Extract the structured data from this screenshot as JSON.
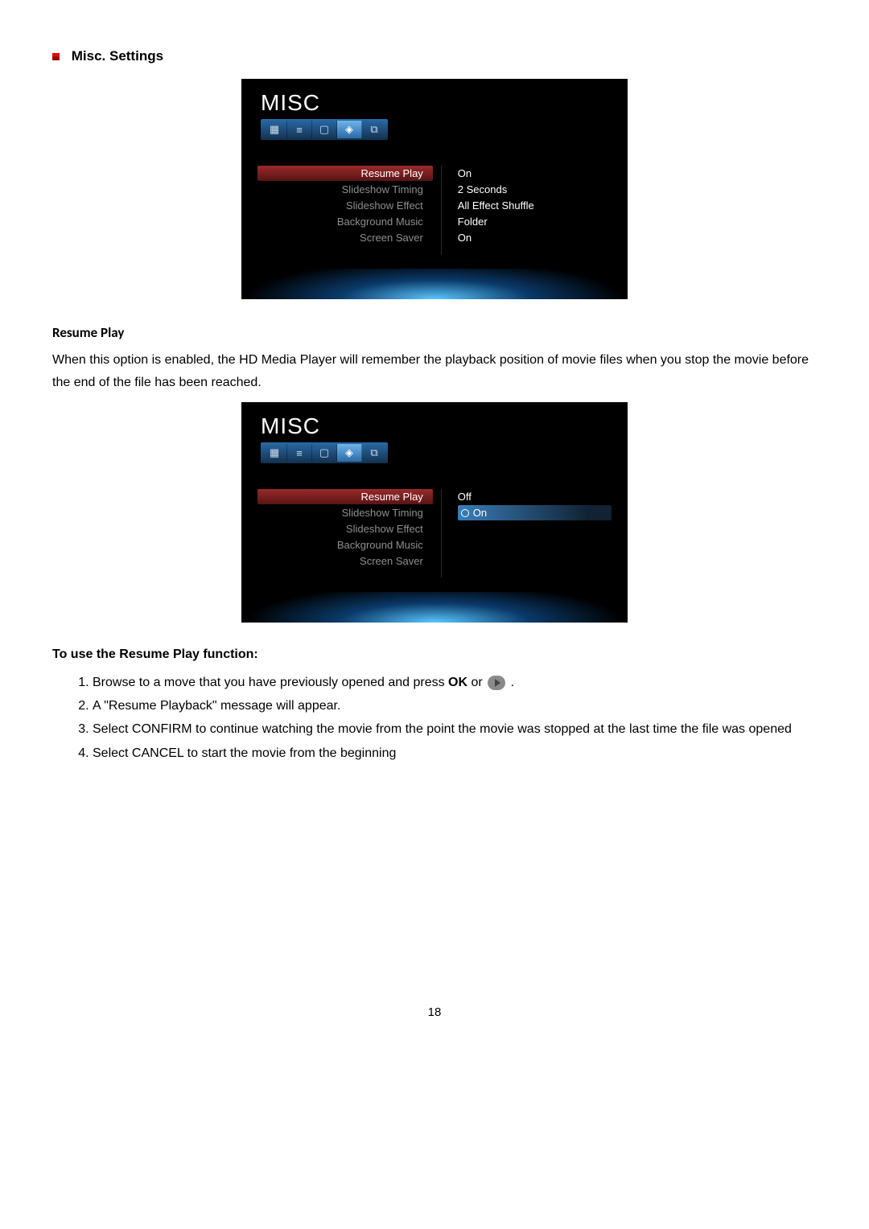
{
  "section_title": "Misc. Settings",
  "screenshot1": {
    "title": "MISC",
    "left": [
      "Resume Play",
      "Slideshow Timing",
      "Slideshow Effect",
      "Background Music",
      "Screen Saver"
    ],
    "right": [
      "On",
      "2 Seconds",
      "All Effect Shuffle",
      "Folder",
      "On"
    ],
    "selected_left_index": 0
  },
  "resume_heading": "Resume Play",
  "resume_para": "When this option is enabled, the HD Media Player will remember the playback position of movie files when you stop the movie before the end of the file has been reached.",
  "screenshot2": {
    "title": "MISC",
    "left": [
      "Resume Play",
      "Slideshow Timing",
      "Slideshow Effect",
      "Background Music",
      "Screen Saver"
    ],
    "right": [
      "Off",
      "On"
    ],
    "selected_left_index": 0,
    "highlight_right_index": 1
  },
  "use_heading": "To use the Resume Play function:",
  "steps": {
    "s1a": "Browse to a move that you have previously opened and press ",
    "s1b": "OK",
    "s1c": " or ",
    "s1d": " .",
    "s2": "A \"Resume Playback\" message will appear.",
    "s3": "Select CONFIRM to continue watching the movie from the point the movie was stopped at the last time the file was opened",
    "s4": "Select CANCEL to start the movie from the beginning"
  },
  "page_number": "18"
}
